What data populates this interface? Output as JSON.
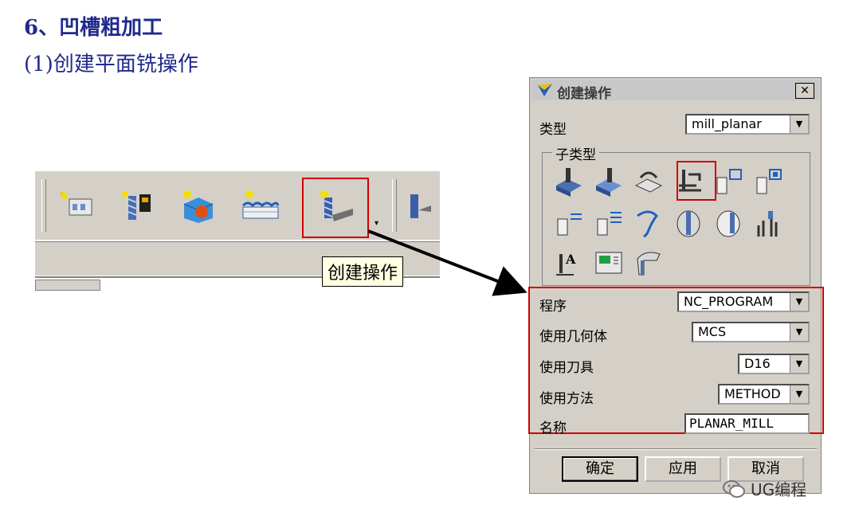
{
  "heading": "6、凹槽粗加工",
  "subheading": "(1)创建平面铣操作",
  "toolbar": {
    "tooltip": "创建操作",
    "buttons": [
      {
        "name": "create-program-icon"
      },
      {
        "name": "create-tool-icon"
      },
      {
        "name": "create-geometry-icon"
      },
      {
        "name": "create-method-icon"
      },
      {
        "name": "create-operation-icon"
      }
    ],
    "dropdown_glyph": "▾"
  },
  "dialog": {
    "title": "创建操作",
    "close_glyph": "✕",
    "type_label": "类型",
    "type_value": "mill_planar",
    "subtype_label": "子类型",
    "program_label": "程序",
    "program_value": "NC_PROGRAM",
    "geometry_label": "使用几何体",
    "geometry_value": "MCS",
    "tool_label": "使用刀具",
    "tool_value": "D16",
    "method_label": "使用方法",
    "method_value": "METHOD",
    "name_label": "名称",
    "name_value": "PLANAR_MILL",
    "ok_label": "确定",
    "apply_label": "应用",
    "cancel_label": "取消",
    "combo_arrow": "▼"
  },
  "watermark": "UG编程",
  "colors": {
    "highlight": "#d00000",
    "heading": "#1f2a8c",
    "dialog_bg": "#d4d0c8"
  }
}
